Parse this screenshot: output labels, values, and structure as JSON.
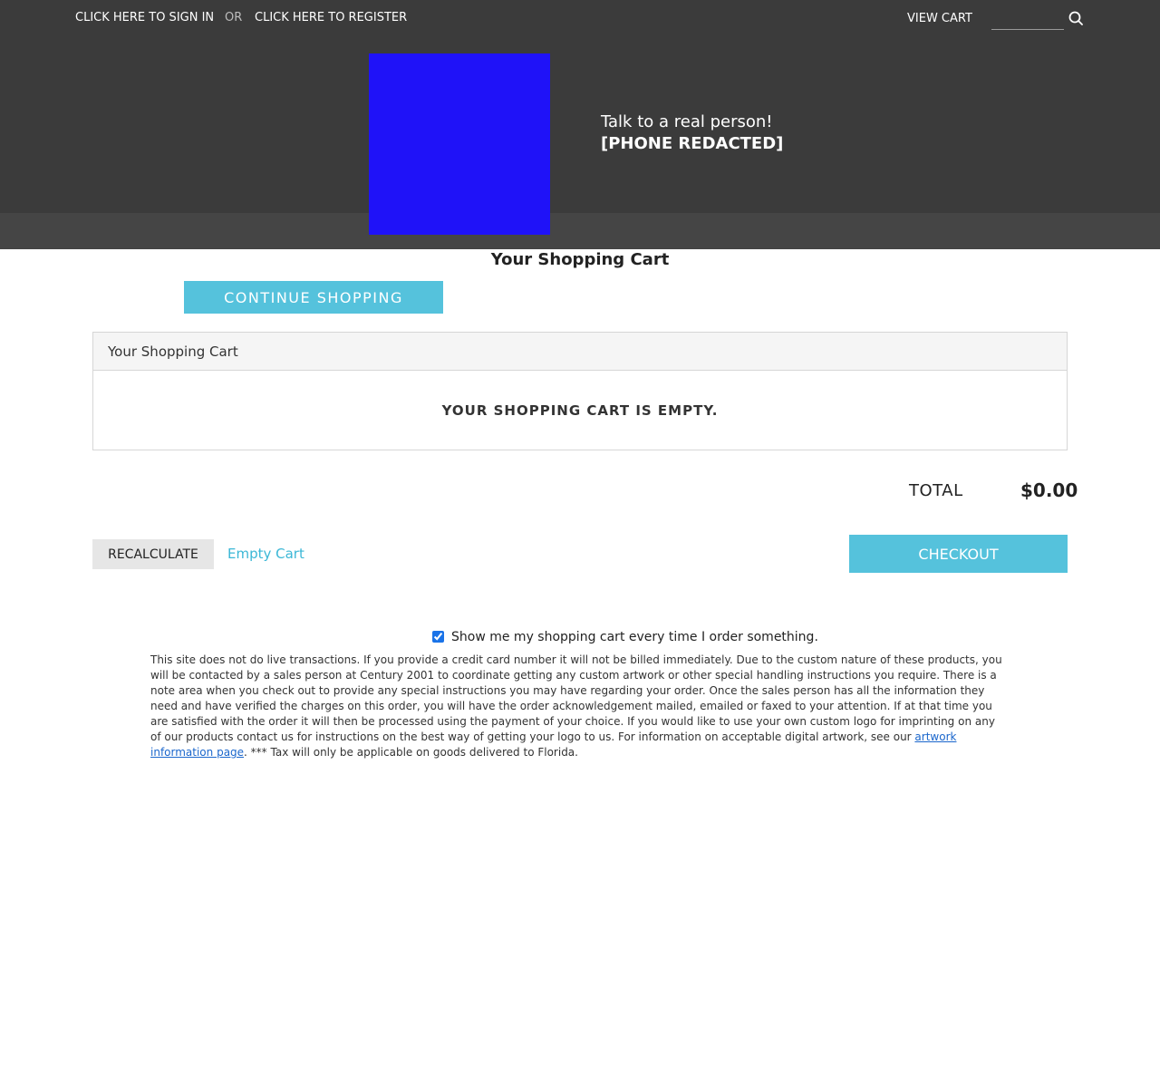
{
  "header": {
    "sign_in": "CLICK HERE TO SIGN IN",
    "or": "OR",
    "register": "CLICK HERE TO REGISTER",
    "view_cart": "VIEW CART",
    "search_value": "",
    "talk_line1": "Talk to a real person!",
    "talk_line2": "[PHONE REDACTED]",
    "logo_color": "#1f12f8",
    "background_color": "#3b3b3b"
  },
  "main": {
    "page_title": "Your Shopping Cart",
    "continue_shopping": "CONTINUE SHOPPING",
    "accent_color": "#55c2dc"
  },
  "cart_panel": {
    "header": "Your Shopping Cart",
    "empty_message": "YOUR SHOPPING CART IS EMPTY."
  },
  "totals": {
    "label": "TOTAL",
    "value": "$0.00"
  },
  "actions": {
    "recalculate": "RECALCULATE",
    "empty_cart": "Empty Cart",
    "checkout": "CHECKOUT"
  },
  "preferences": {
    "show_cart_label": "Show me my shopping cart every time I order something.",
    "show_cart_checked": true
  },
  "notice": {
    "text_before": "This site does not do live transactions. If you provide a credit card number it will not be billed immediately. Due to the custom nature of these products, you will be contacted by a sales person at Century 2001 to coordinate getting any custom artwork or other special handling instructions you require. There is a note area when you check out to provide any special instructions you may have regarding your order. Once the sales person has all the information they need and have verified the charges on this order, you will have the order acknowledgement mailed, emailed or faxed to your attention. If at that time you are satisfied with the order it will then be processed using the payment of your choice. If you would like to use your own custom logo for imprinting on any of our products contact us for instructions on the best way of getting your logo to us. For information on acceptable digital artwork, see our ",
    "link_text": "artwork information page",
    "text_after": ". *** Tax will only be applicable on goods delivered to Florida."
  },
  "icons": {
    "search": "search-icon"
  }
}
